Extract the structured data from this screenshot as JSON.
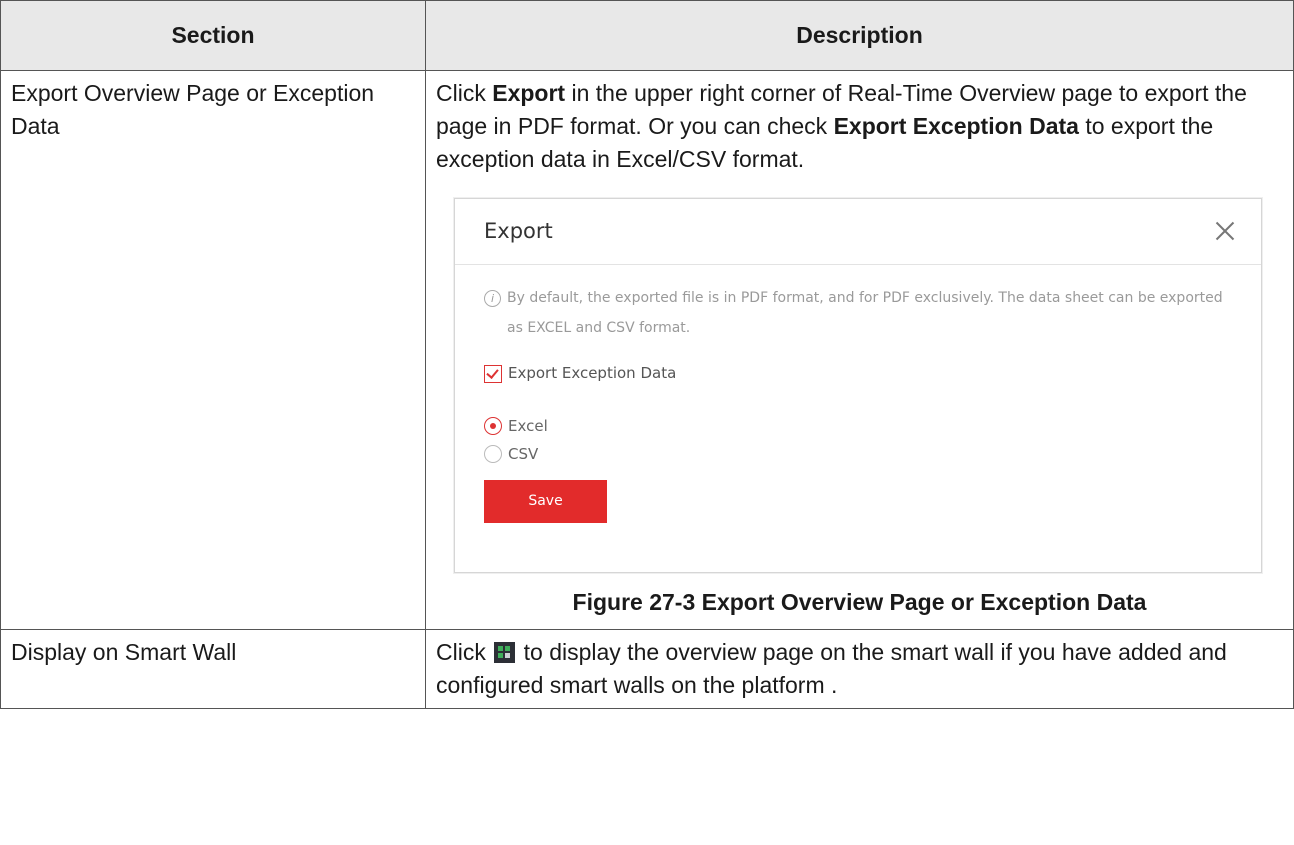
{
  "table": {
    "headers": [
      "Section",
      "Description"
    ],
    "rows": [
      {
        "section": "Export Overview Page or Exception Data",
        "desc": {
          "p1_a": "Click ",
          "p1_b1": "Export",
          "p1_c": " in the upper right corner of Real-Time Overview page to export the page in PDF format. Or you can check ",
          "p1_b2": "Export Exception Data",
          "p1_d": " to export the exception data in Excel/CSV format."
        },
        "figure": {
          "dialog_title": "Export",
          "note": "By default, the exported file is in PDF format, and for PDF exclusively. The data sheet can be exported as EXCEL and CSV format.",
          "checkbox_label": "Export Exception Data",
          "radio_options": [
            "Excel",
            "CSV"
          ],
          "selected_option": "Excel",
          "save_label": "Save",
          "accent_color": "#e22b2b",
          "caption": "Figure 27-3 Export Overview Page or Exception Data"
        }
      },
      {
        "section": "Display on Smart Wall",
        "desc": {
          "a": "Click ",
          "icon": "smart-wall-icon",
          "b": " to display the overview page on the smart wall if you have added and configured smart walls on the platform ."
        }
      }
    ]
  }
}
